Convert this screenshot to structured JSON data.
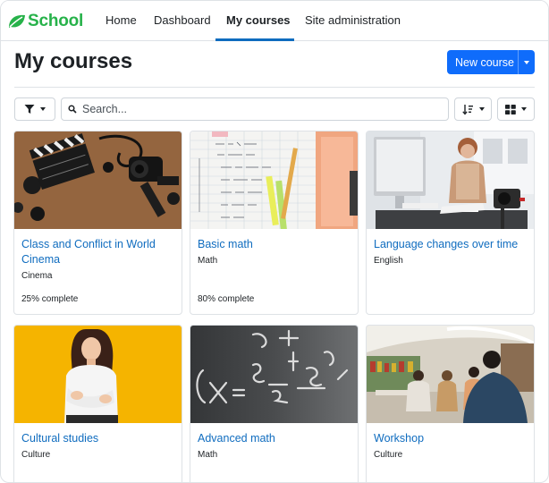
{
  "brand": {
    "name": "School",
    "color": "#27b24a"
  },
  "nav": {
    "items": [
      {
        "label": "Home",
        "active": false
      },
      {
        "label": "Dashboard",
        "active": false
      },
      {
        "label": "My courses",
        "active": true
      },
      {
        "label": "Site administration",
        "active": false
      }
    ]
  },
  "page": {
    "title": "My courses"
  },
  "actions": {
    "new_course": "New course"
  },
  "toolbar": {
    "search_placeholder": "Search...",
    "filter_icon": "filter-icon",
    "sort_icon": "sort-icon",
    "view_icon": "grid-view-icon"
  },
  "courses": [
    {
      "title": "Class and Conflict in World Cinema",
      "category": "Cinema",
      "progress": "25% complete",
      "image": "film-clapperboard-camera"
    },
    {
      "title": "Basic math",
      "category": "Math",
      "progress": "80% complete",
      "image": "handwritten-math-notebook"
    },
    {
      "title": "Language changes over time",
      "category": "English",
      "progress": "",
      "image": "woman-at-desk-computer"
    },
    {
      "title": "Cultural studies",
      "category": "Culture",
      "progress": "",
      "image": "student-on-yellow-background"
    },
    {
      "title": "Advanced math",
      "category": "Math",
      "progress": "",
      "image": "chalkboard-equations"
    },
    {
      "title": "Workshop",
      "category": "Culture",
      "progress": "",
      "image": "library-classroom"
    }
  ],
  "colors": {
    "accent": "#0f6cbf",
    "button": "#0f6cfb",
    "border": "#dee2e6"
  }
}
